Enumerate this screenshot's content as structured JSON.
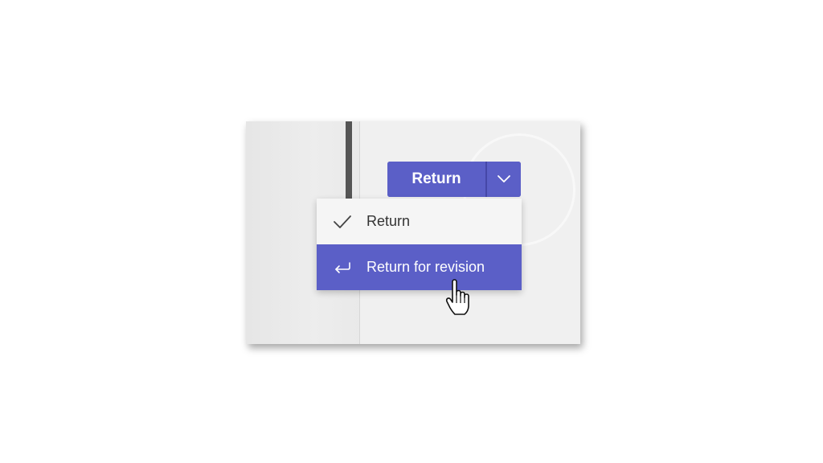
{
  "split_button": {
    "label": "Return",
    "arrow_icon": "chevron-down-icon"
  },
  "menu": {
    "items": [
      {
        "label": "Return",
        "icon": "checkmark-icon",
        "selected": false
      },
      {
        "label": "Return for revision",
        "icon": "return-arrow-icon",
        "selected": true
      }
    ]
  },
  "colors": {
    "accent": "#5b5fc7",
    "panel_bg": "#f0f0f0",
    "menu_bg": "#f5f5f5",
    "text": "#333333"
  },
  "cursor": "hand-pointer-icon"
}
